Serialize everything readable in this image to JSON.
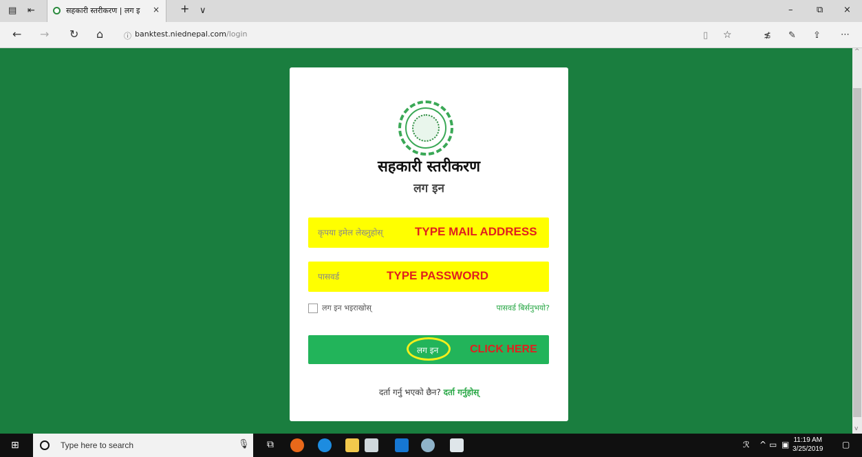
{
  "browser": {
    "tab_title": "सहकारी स्तरीकरण | लग इ",
    "tab_close": "×",
    "new_tab": "+",
    "tab_list": "∨",
    "url_host": "banktest.niednepal.com",
    "url_path": "/login",
    "window": {
      "minimize": "–",
      "restore": "⧉",
      "close": "×"
    }
  },
  "login": {
    "title": "सहकारी स्तरीकरण",
    "subtitle": "लग इन",
    "email_placeholder": "कृपया इमेल लेख्नुहोस्",
    "password_placeholder": "पासवर्ड",
    "remember_label": "लग इन भइराखोस्",
    "forgot_link": "पासवर्ड बिर्सनुभयो?",
    "login_button": "लग इन",
    "register_text": "दर्ता गर्नु भएको छैन?",
    "register_link": "दर्ता गर्नुहोस्"
  },
  "annotations": {
    "email": "TYPE MAIL ADDRESS",
    "password": "TYPE PASSWORD",
    "click": "CLICK HERE"
  },
  "taskbar": {
    "search_placeholder": "Type here to search",
    "time": "11:19 AM",
    "date": "3/25/2019"
  },
  "colors": {
    "page_bg": "#1a7e3f",
    "field_bg": "#ffff00",
    "button_bg": "#22b45a",
    "annotation": "#e0201e",
    "link": "#28a745"
  }
}
